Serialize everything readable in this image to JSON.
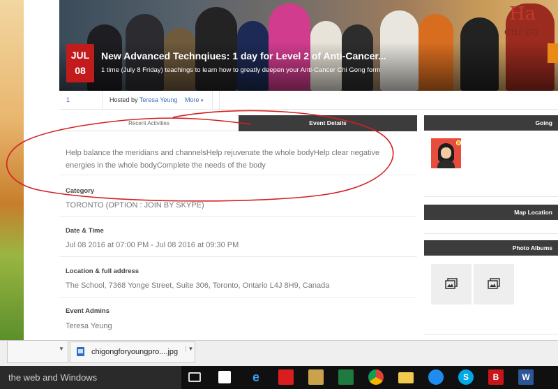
{
  "banner": {
    "date_month": "JUL",
    "date_day": "08",
    "title": "New Advanced Technqiues: 1 day for Level 2 of Anti-Cancer...",
    "subtitle": "1 time (July 8 Friday) teachings to learn how to greatly deepen your Anti-Cancer Chi Gong form",
    "sign_text": "Ha",
    "sign_subtext": "CHI GO"
  },
  "meta": {
    "attendees": "1 attendee",
    "hosted_by": "Hosted by",
    "host_name": "Teresa Yeung",
    "more": "More"
  },
  "tabs": {
    "recent": "Recent Activities",
    "details": "Event Details"
  },
  "details": {
    "description": "Help balance the meridians and channelsHelp rejuvenate the whole bodyHelp clear negative energies in the whole bodyComplete the needs of the body",
    "category_label": "Category",
    "category_value": "TORONTO (OPTION : JOIN BY SKYPE)",
    "datetime_label": "Date & Time",
    "datetime_value": "Jul 08 2016 at 07:00 PM - Jul 08 2016 at 09:30 PM",
    "location_label": "Location & full address",
    "location_value": "The School, 7368 Yonge Street, Suite 306, Toronto, Ontario L4J 8H9, Canada",
    "admins_label": "Event Admins",
    "admins_value": "Teresa Yeung"
  },
  "sidebar": {
    "going": "Going",
    "map": "Map Location",
    "albums": "Photo Albums"
  },
  "download": {
    "filename": "chigongforyoungpro....jpg"
  },
  "taskbar": {
    "search_text": "the web and Windows",
    "icons": [
      "task-view-icon",
      "store-icon",
      "edge-icon",
      "acrobat-icon",
      "media-icon",
      "excel-icon",
      "chrome-icon",
      "folder-icon",
      "messenger-icon",
      "skype-icon",
      "b-app-icon",
      "word-icon"
    ]
  },
  "colors": {
    "accent_red": "#c21b1b",
    "link_blue": "#3b6dba",
    "dark_header": "#3c3c3c",
    "annotation_red": "#d42020"
  }
}
